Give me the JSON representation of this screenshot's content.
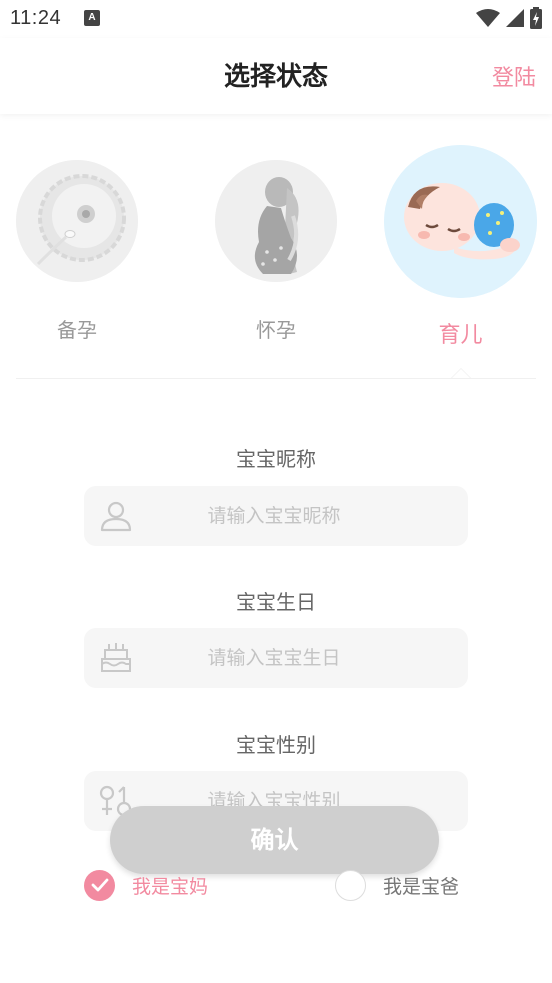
{
  "status_bar": {
    "time": "11:24",
    "notification_icon": "A"
  },
  "header": {
    "title": "选择状态",
    "login_label": "登陆"
  },
  "stages": [
    {
      "label": "备孕",
      "icon": "egg-sperm-icon",
      "selected": false
    },
    {
      "label": "怀孕",
      "icon": "pregnant-woman-icon",
      "selected": false
    },
    {
      "label": "育儿",
      "icon": "sleeping-baby-icon",
      "selected": true
    }
  ],
  "form": {
    "nickname": {
      "label": "宝宝昵称",
      "placeholder": "请输入宝宝昵称",
      "value": "",
      "icon": "person-icon"
    },
    "birthday": {
      "label": "宝宝生日",
      "placeholder": "请输入宝宝生日",
      "value": "",
      "icon": "birthday-cake-icon"
    },
    "gender": {
      "label": "宝宝性别",
      "placeholder": "请输入宝宝性别",
      "value": "",
      "icon": "gender-icon"
    }
  },
  "confirm_label": "确认",
  "roles": [
    {
      "label": "我是宝妈",
      "checked": true
    },
    {
      "label": "我是宝爸",
      "checked": false
    }
  ],
  "colors": {
    "accent_pink": "#f28aa0",
    "button_gray": "#cfcfcf",
    "selected_circle": "#dff3fd"
  }
}
